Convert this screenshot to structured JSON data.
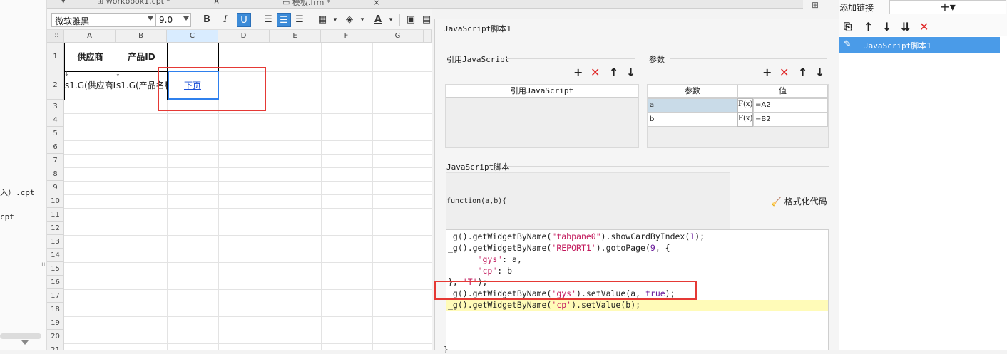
{
  "left_panel": {
    "tree_items": [
      "入）.cpt",
      "cpt"
    ],
    "splitter_glyph": "ıı"
  },
  "tabs": [
    {
      "label": "workbook1.cpt *",
      "icon": "workbook-icon",
      "close": "×"
    },
    {
      "label": "模板.frm *",
      "icon": "form-icon",
      "close": "×"
    }
  ],
  "toolbar": {
    "font_name": "微软雅黑",
    "font_size": "9.0",
    "bold": "B",
    "italic": "I",
    "underline": "U"
  },
  "sheet": {
    "corner_label": ":::",
    "columns": [
      "A",
      "B",
      "C",
      "D",
      "E",
      "F",
      "G"
    ],
    "rows": [
      "1",
      "2",
      "3",
      "4",
      "5",
      "6",
      "7",
      "8",
      "9",
      "10",
      "11",
      "12",
      "13",
      "14",
      "15",
      "16",
      "17",
      "18",
      "19",
      "20",
      "21"
    ],
    "cells": {
      "A1": "供应商",
      "B1": "产品ID",
      "A2": "s1.G(供应商I",
      "B2": "s1.G(产品名称",
      "C2": "下页"
    }
  },
  "dialog": {
    "title": "JavaScript脚本1",
    "ref_section": {
      "label": "引用JavaScript",
      "column_header": "引用JavaScript"
    },
    "param_section": {
      "label": "参数",
      "headers": [
        "参数",
        "值"
      ],
      "rows": [
        {
          "name": "a",
          "fx": "F(x)",
          "value": "=A2"
        },
        {
          "name": "b",
          "fx": "F(x)",
          "value": "=B2"
        }
      ]
    },
    "script_section": {
      "label": "JavaScript脚本",
      "signature": "function(a,b){",
      "format_button": "格式化代码"
    },
    "code_lines": [
      [
        [
          "_g().getWidgetByName(",
          ""
        ],
        [
          "\"tabpane0\"",
          "str"
        ],
        [
          ").showCardByIndex(",
          ""
        ],
        [
          "1",
          "num"
        ],
        [
          ");",
          ""
        ]
      ],
      [
        [
          "_g().getWidgetByName(",
          ""
        ],
        [
          "'REPORT1'",
          "str"
        ],
        [
          ").gotoPage(",
          ""
        ],
        [
          "9",
          "num"
        ],
        [
          ", {",
          ""
        ]
      ],
      [
        [
          "      ",
          ""
        ],
        [
          "\"gys\"",
          "str"
        ],
        [
          ": a,",
          ""
        ]
      ],
      [
        [
          "      ",
          ""
        ],
        [
          "\"cp\"",
          "str"
        ],
        [
          ": b",
          ""
        ]
      ],
      [
        [
          "}, ",
          ""
        ],
        [
          "'T'",
          "str"
        ],
        [
          ");",
          ""
        ]
      ],
      [
        [
          "_g().getWidgetByName(",
          ""
        ],
        [
          "'gys'",
          "str"
        ],
        [
          ").setValue(a, ",
          ""
        ],
        [
          "true",
          "kw"
        ],
        [
          ");",
          ""
        ]
      ],
      [
        [
          "_g().getWidgetByName(",
          ""
        ],
        [
          "'cp'",
          "str"
        ],
        [
          ").setValue(b);",
          ""
        ]
      ]
    ],
    "closing_brace": "}"
  },
  "right_panel": {
    "title": "添加链接",
    "add_button": "+▾",
    "items": [
      "JavaScript脚本1"
    ]
  },
  "colors": {
    "selection_blue": "#2f80ed",
    "highlight_red": "#e53935",
    "list_selected": "#4a9be8",
    "string_color": "#c2185b"
  }
}
